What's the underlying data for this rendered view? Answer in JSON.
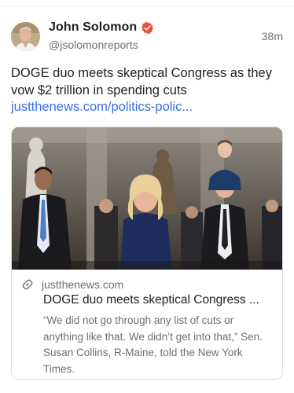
{
  "post": {
    "author_name": "John Solomon",
    "handle": "@jsolomonreports",
    "timestamp": "38m",
    "text": "DOGE duo meets skeptical Congress as they vow $2 trillion in spending cuts",
    "link": "justthenews.com/politics-polic..."
  },
  "embed": {
    "domain": "justthenews.com",
    "title": "DOGE duo meets skeptical Congress ...",
    "description": "“We did not go through any list of cuts or anything like that. We didn’t get into that,” Sen. Susan Collins, R-Maine, told the New York Times."
  },
  "colors": {
    "verified_badge": "#f04e37",
    "link": "#3a6ee8"
  },
  "icons": {
    "verified": "verified-badge-icon",
    "link": "link-icon"
  }
}
